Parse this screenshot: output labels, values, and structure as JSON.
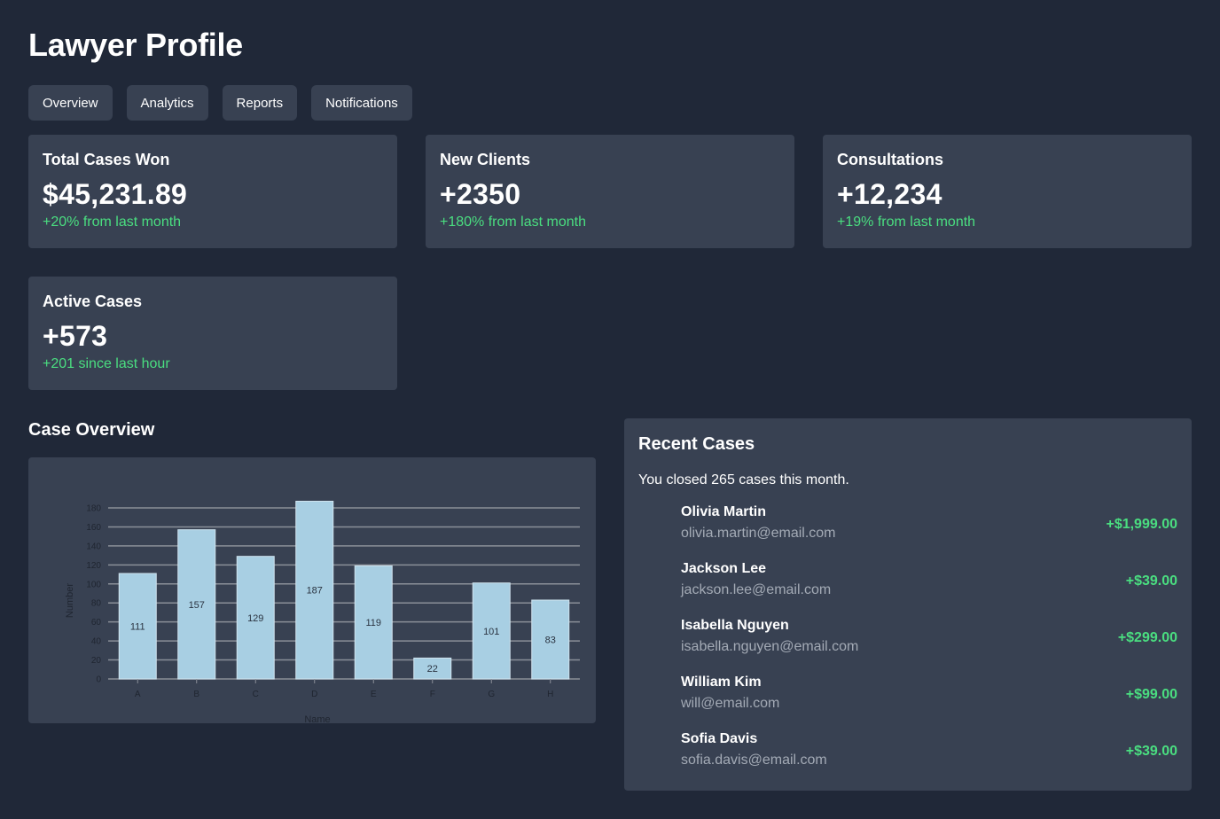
{
  "header": {
    "title": "Lawyer Profile"
  },
  "tabs": [
    {
      "label": "Overview"
    },
    {
      "label": "Analytics"
    },
    {
      "label": "Reports"
    },
    {
      "label": "Notifications"
    }
  ],
  "stats": [
    {
      "label": "Total Cases Won",
      "value": "$45,231.89",
      "change": "+20% from last month"
    },
    {
      "label": "New Clients",
      "value": "+2350",
      "change": "+180% from last month"
    },
    {
      "label": "Consultations",
      "value": "+12,234",
      "change": "+19% from last month"
    },
    {
      "label": "Active Cases",
      "value": "+573",
      "change": "+201 since last hour"
    }
  ],
  "overview": {
    "title": "Case Overview"
  },
  "chart_data": {
    "type": "bar",
    "categories": [
      "A",
      "B",
      "C",
      "D",
      "E",
      "F",
      "G",
      "H"
    ],
    "values": [
      111,
      157,
      129,
      187,
      119,
      22,
      101,
      83
    ],
    "xlabel": "Name",
    "ylabel": "Number",
    "ylim": [
      0,
      180
    ],
    "yticks": [
      0,
      20,
      40,
      60,
      80,
      100,
      120,
      140,
      160,
      180
    ],
    "grid": true,
    "bar_color": "#a8cfe3",
    "data_labels": true
  },
  "recent": {
    "title": "Recent Cases",
    "subtitle": "You closed 265 cases this month.",
    "items": [
      {
        "name": "Olivia Martin",
        "email": "olivia.martin@email.com",
        "amount": "+$1,999.00"
      },
      {
        "name": "Jackson Lee",
        "email": "jackson.lee@email.com",
        "amount": "+$39.00"
      },
      {
        "name": "Isabella Nguyen",
        "email": "isabella.nguyen@email.com",
        "amount": "+$299.00"
      },
      {
        "name": "William Kim",
        "email": "will@email.com",
        "amount": "+$99.00"
      },
      {
        "name": "Sofia Davis",
        "email": "sofia.davis@email.com",
        "amount": "+$39.00"
      }
    ]
  },
  "colors": {
    "background": "#202838",
    "card": "#384152",
    "positive": "#4ade80",
    "muted_text": "#a3aab5"
  }
}
